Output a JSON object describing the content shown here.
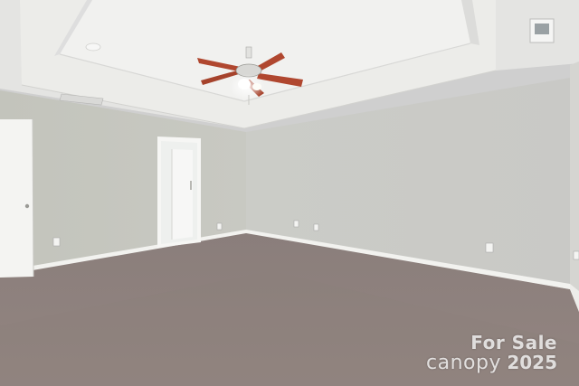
{
  "watermark": {
    "line1": "For Sale",
    "brand": "canopy",
    "year": "2025"
  },
  "colors": {
    "wall_left": "#c6c7c0",
    "wall_back": "#cdcdca",
    "ceiling": "#e9e9e7",
    "carpet": "#8f817d",
    "trim": "#f4f4f2",
    "fan_blade": "#b2472e"
  }
}
